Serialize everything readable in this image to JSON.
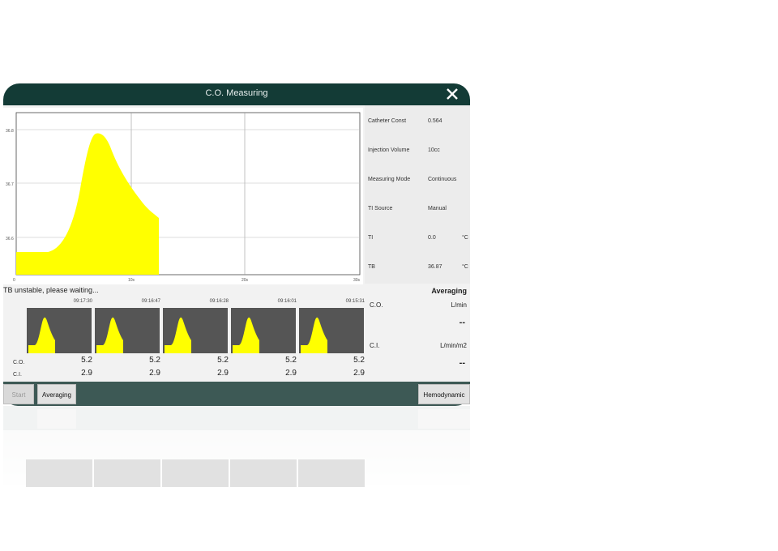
{
  "window": {
    "title": "C.O. Measuring",
    "close_icon": "close-icon"
  },
  "graph": {
    "y_ticks": [
      "36.8",
      "36.7",
      "36.6"
    ],
    "x_ticks": [
      "0",
      "10s",
      "20s",
      "30s"
    ],
    "curve_color": "#ffff00"
  },
  "params": [
    {
      "label": "Catheter Const",
      "value": "0.564",
      "unit": ""
    },
    {
      "label": "Injection Volume",
      "value": "10cc",
      "unit": ""
    },
    {
      "label": "Measuring Mode",
      "value": "Continuous",
      "unit": ""
    },
    {
      "label": "TI Source",
      "value": "Manual",
      "unit": ""
    },
    {
      "label": "TI",
      "value": "0.0",
      "unit": "°C"
    },
    {
      "label": "TB",
      "value": "36.87",
      "unit": "°C"
    }
  ],
  "status": "TB unstable, please waiting...",
  "history": {
    "co_label": "C.O.",
    "ci_label": "C.I.",
    "items": [
      {
        "time": "09:17:30",
        "co": "5.2",
        "ci": "2.9"
      },
      {
        "time": "09:16:47",
        "co": "5.2",
        "ci": "2.9"
      },
      {
        "time": "09:16:28",
        "co": "5.2",
        "ci": "2.9"
      },
      {
        "time": "09:16:01",
        "co": "5.2",
        "ci": "2.9"
      },
      {
        "time": "09:15:31",
        "co": "5.2",
        "ci": "2.9"
      }
    ]
  },
  "averaging": {
    "heading": "Averaging",
    "co_label": "C.O.",
    "co_unit": "L/min",
    "co_value": "--",
    "ci_label": "C.I.",
    "ci_unit": "L/min/m2",
    "ci_value": "--"
  },
  "buttons": {
    "start": "Start",
    "averaging": "Averaging",
    "hemodynamic": "Hemodynamic"
  }
}
